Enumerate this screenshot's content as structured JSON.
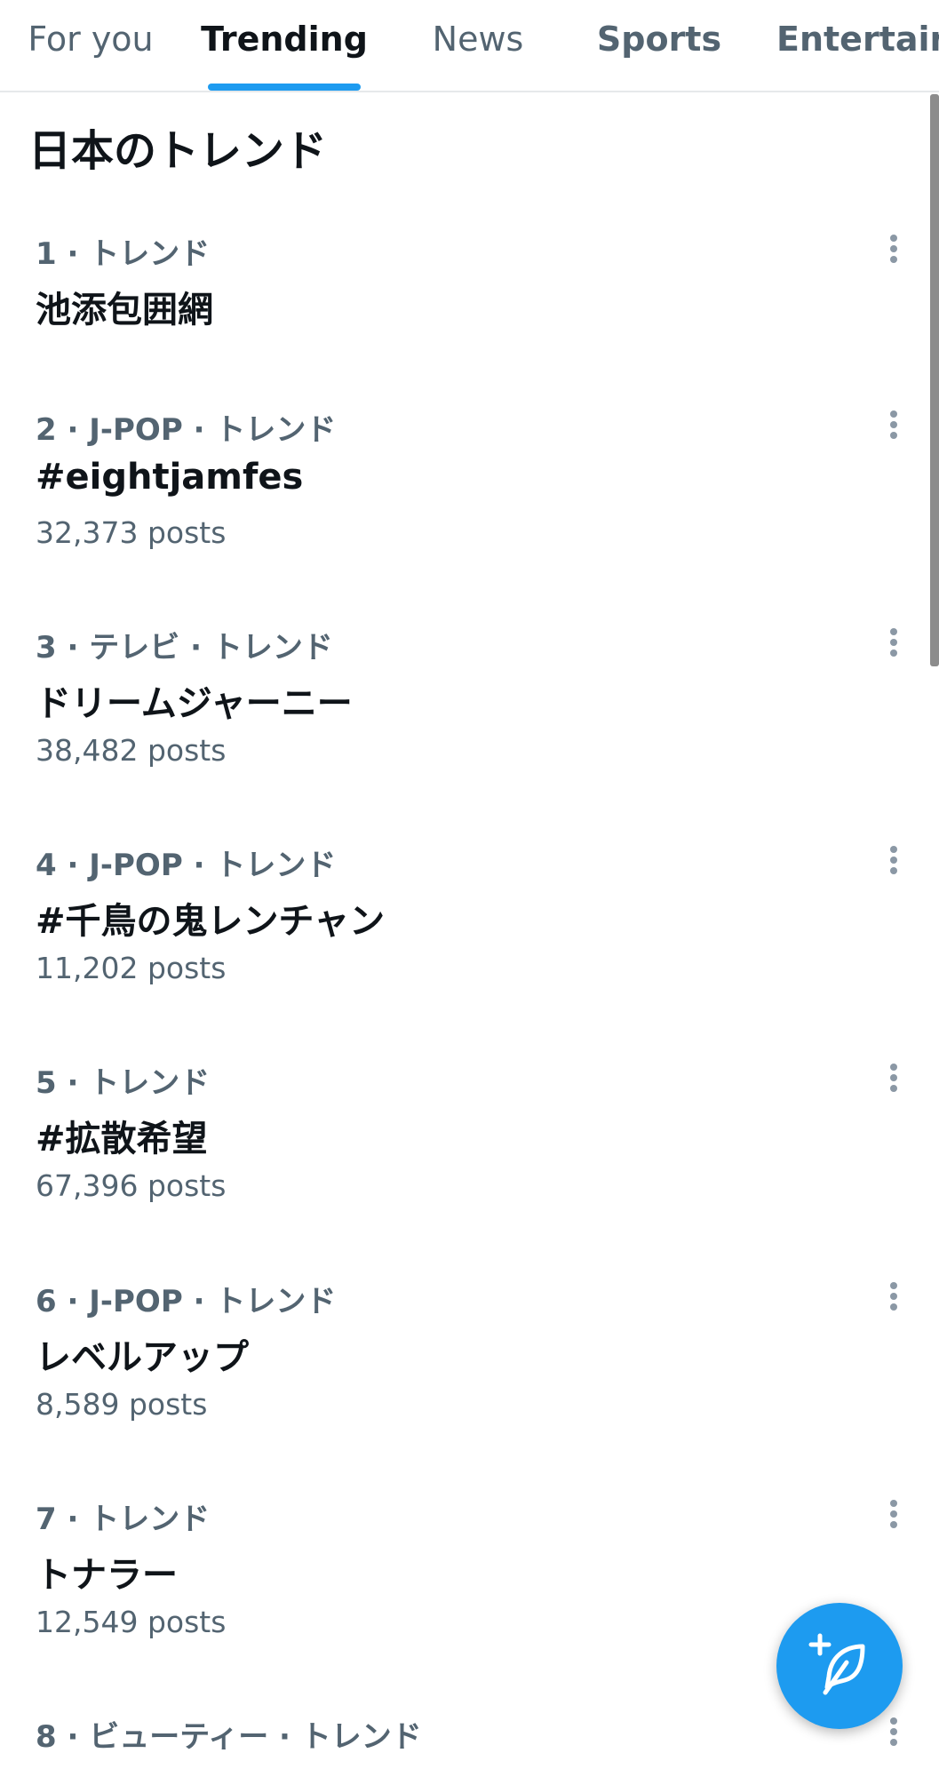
{
  "tabs": [
    {
      "label": "For you",
      "active": false
    },
    {
      "label": "Trending",
      "active": true
    },
    {
      "label": "News",
      "active": false
    },
    {
      "label": "Sports",
      "active": false
    },
    {
      "label": "Entertain",
      "active": false
    }
  ],
  "section": {
    "title": "日本のトレンド"
  },
  "trends": [
    {
      "meta": "1 · トレンド",
      "name": "池添包囲網",
      "count": ""
    },
    {
      "meta": "2 · J-POP · トレンド",
      "name": "#eightjamfes",
      "count": "32,373 posts"
    },
    {
      "meta": "3 · テレビ · トレンド",
      "name": "ドリームジャーニー",
      "count": "38,482 posts"
    },
    {
      "meta": "4 · J-POP · トレンド",
      "name": "#千鳥の鬼レンチャン",
      "count": "11,202 posts"
    },
    {
      "meta": "5 · トレンド",
      "name": "#拡散希望",
      "count": "67,396 posts"
    },
    {
      "meta": "6 · J-POP · トレンド",
      "name": "レベルアップ",
      "count": "8,589 posts"
    },
    {
      "meta": "7 · トレンド",
      "name": "トナラー",
      "count": "12,549 posts"
    },
    {
      "meta": "8 · ビューティー · トレンド",
      "name": "",
      "count": ""
    }
  ],
  "colors": {
    "accent": "#1d9bf0",
    "primary_text": "#0f1419",
    "secondary_text": "#536471"
  },
  "icons": {
    "more": "more-vertical-icon",
    "compose": "compose-post-icon"
  }
}
